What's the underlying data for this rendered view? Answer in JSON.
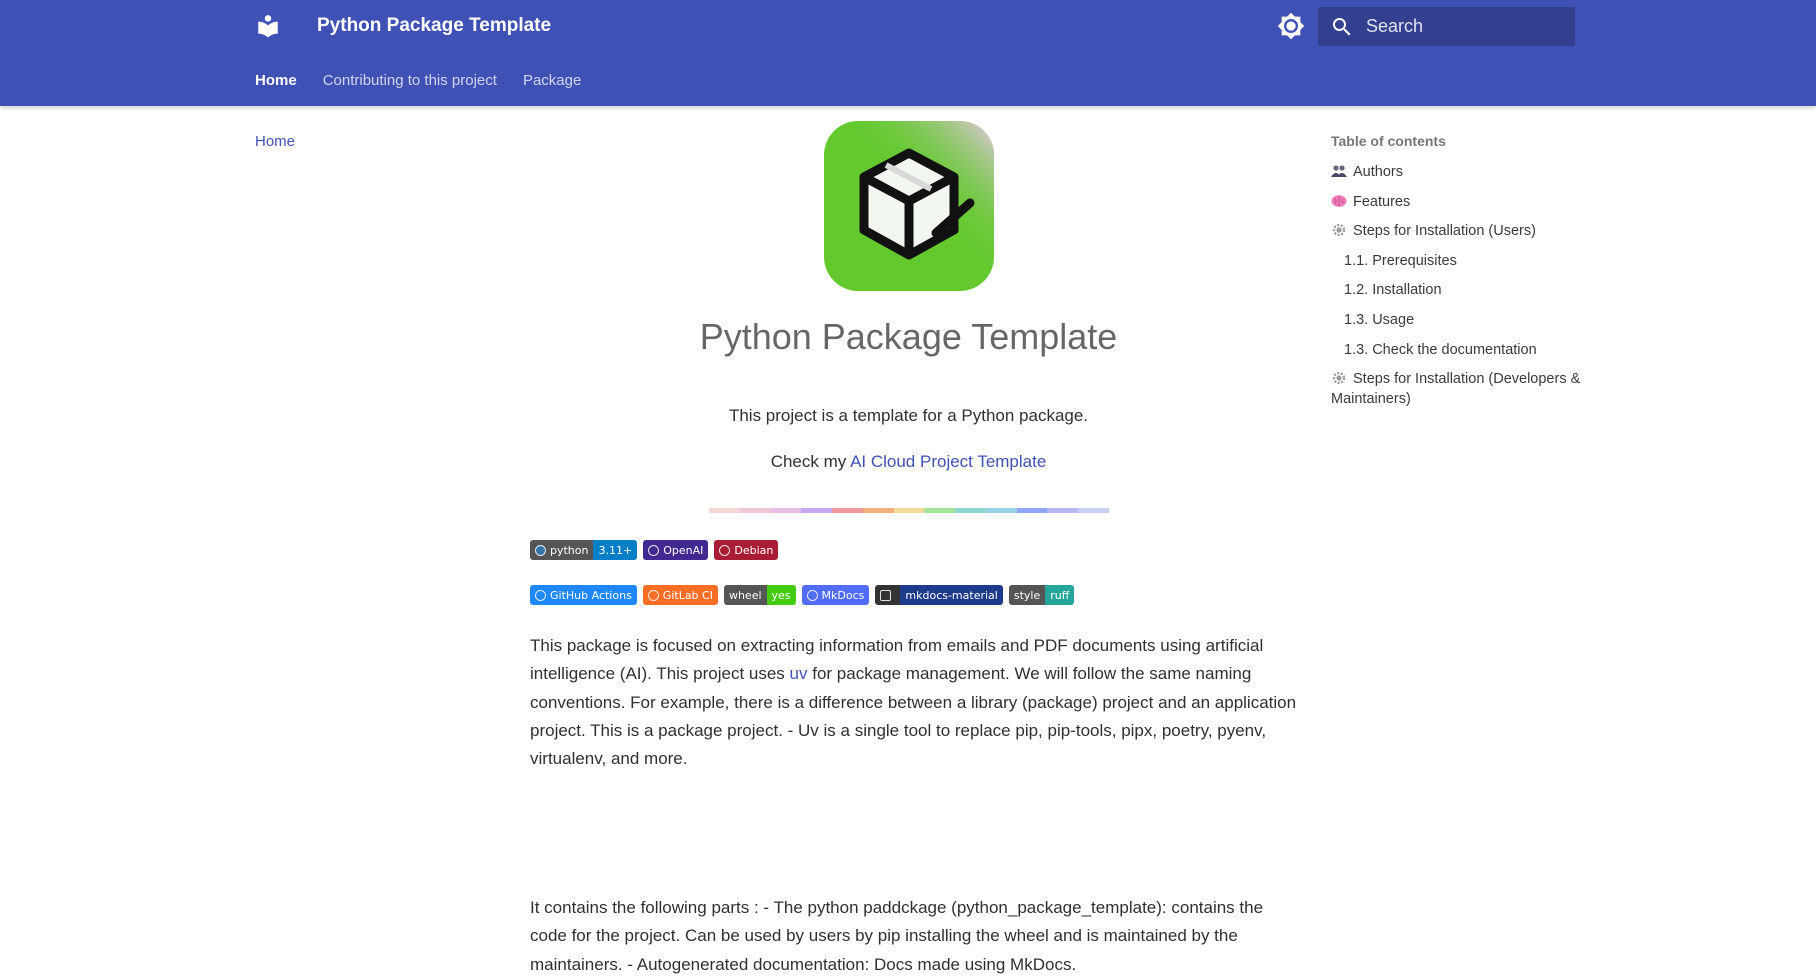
{
  "header": {
    "site_title": "Python Package Template",
    "search_placeholder": "Search",
    "tabs": [
      {
        "label": "Home",
        "active": true
      },
      {
        "label": "Contributing to this project",
        "active": false
      },
      {
        "label": "Package",
        "active": false
      }
    ],
    "primary_color": "#4051b5"
  },
  "left_nav": {
    "items": [
      {
        "label": "Home"
      }
    ]
  },
  "content": {
    "title": "Python Package Template",
    "intro": "This project is a template for a Python package.",
    "check_prefix": "Check my ",
    "check_link": "AI Cloud Project Template",
    "badges_row1": [
      {
        "label": "python",
        "value": "3.11+",
        "label_color": "#555555",
        "value_color": "#007ec6"
      },
      {
        "label": "OpenAI",
        "value": "",
        "label_color": "#412991",
        "value_color": ""
      },
      {
        "label": "Debian",
        "value": "",
        "label_color": "#a81d33",
        "value_color": ""
      }
    ],
    "badges_row2": [
      {
        "label": "GitHub Actions",
        "value": "",
        "label_color": "#2088ff",
        "value_color": ""
      },
      {
        "label": "GitLab CI",
        "value": "",
        "label_color": "#fc6d26",
        "value_color": ""
      },
      {
        "label": "wheel",
        "value": "yes",
        "label_color": "#555555",
        "value_color": "#4c1"
      },
      {
        "label": "MkDocs",
        "value": "",
        "label_color": "#526cfe",
        "value_color": ""
      },
      {
        "label": "mkdocs-material",
        "value": "",
        "label_color": "#000000",
        "value_color": "#1e3a8a"
      },
      {
        "label": "style",
        "value": "ruff",
        "label_color": "#555555",
        "value_color": "#26a69a"
      }
    ],
    "para1_before": "This package is focused on extracting information from emails and PDF documents using artificial intelligence (AI). This project uses ",
    "para1_link": "uv",
    "para1_after": " for package management. We will follow the same naming conventions. For example, there is a difference between a library (package) project and an application project. This is a package project. - Uv is a single tool to replace pip, pip-tools, pipx, poetry, pyenv, virtualenv, and more.",
    "para2": "It contains the following parts : - The python paddckage (python_package_template): contains the code for the project. Can be used by users by pip installing the wheel and is maintained by the maintainers. - Autogenerated documentation: Docs made using MkDocs."
  },
  "toc": {
    "title": "Table of contents",
    "items": [
      {
        "label": "Authors",
        "icon": "people-icon"
      },
      {
        "label": "Features",
        "icon": "brain-icon"
      },
      {
        "label": "Steps for Installation (Users)",
        "icon": "gear-icon"
      },
      {
        "label": "1.1. Prerequisites",
        "icon": ""
      },
      {
        "label": "1.2. Installation",
        "icon": ""
      },
      {
        "label": "1.3. Usage",
        "icon": ""
      },
      {
        "label": "1.3. Check the documentation",
        "icon": ""
      },
      {
        "label": "Steps for Installation (Developers & Maintainers)",
        "icon": "gear-icon"
      }
    ]
  }
}
